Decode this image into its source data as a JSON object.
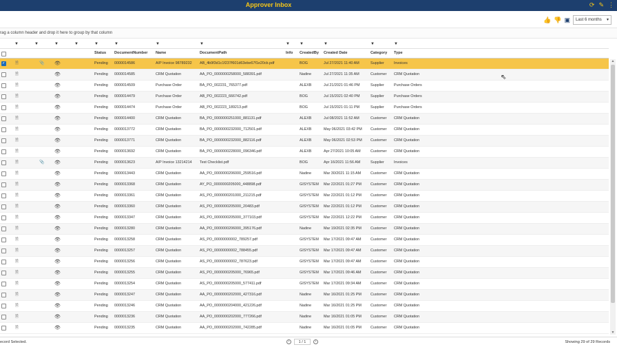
{
  "titlebar": {
    "title": "Approver Inbox",
    "icons": [
      "refresh-icon",
      "edit-icon",
      "more-icon"
    ]
  },
  "toolbar": {
    "icons": [
      "thumbs-up-icon",
      "thumbs-down-icon",
      "chat-icon"
    ],
    "period": "Last 6 months"
  },
  "groupbar": {
    "text": "rag a column header and drop it here to group by that column"
  },
  "columns": {
    "status": "Status",
    "number": "DocumentNumber",
    "name": "Name",
    "path": "DocumentPath",
    "info": "Info",
    "created_by": "CreatedBy",
    "created_date": "Created Date",
    "category": "Category",
    "type": "Type"
  },
  "rows": [
    {
      "status": "Pending",
      "number": "0000014586",
      "name": "A/P Invoice 98789232",
      "path": "AB_4b9f3d1c1f237f601d63ebe67f1e20cb.pdf",
      "by": "BOG",
      "date": "Jul 27/2021 11:40 AM",
      "cat": "Supplier",
      "type": "Invoices",
      "clip": true,
      "selected": true
    },
    {
      "status": "Pending",
      "number": "0000014585",
      "name": "CRM Quotation",
      "path": "AA_PO_0000000258000_588391.pdf",
      "by": "Nadine",
      "date": "Jul 27/2021 11:35 AM",
      "cat": "Customer",
      "type": "CRM Quotation"
    },
    {
      "status": "Pending",
      "number": "0000014509",
      "name": "Purchase Order",
      "path": "BA_PO_002231_765377.pdf",
      "by": "ALEXB",
      "date": "Jul 21/2021 01:46 PM",
      "cat": "Supplier",
      "type": "Purchase Orders"
    },
    {
      "status": "Pending",
      "number": "0000014479",
      "name": "Purchase Order",
      "path": "AB_PO_002223_666742.pdf",
      "by": "BOG",
      "date": "Jul 15/2021 02:40 PM",
      "cat": "Supplier",
      "type": "Purchase Orders"
    },
    {
      "status": "Pending",
      "number": "0000014474",
      "name": "Purchase Order",
      "path": "AB_PO_002223_189213.pdf",
      "by": "BOG",
      "date": "Jul 15/2021 01:11 PM",
      "cat": "Supplier",
      "type": "Purchase Orders"
    },
    {
      "status": "Pending",
      "number": "0000014400",
      "name": "CRM Quotation",
      "path": "BA_PO_0000000251000_881131.pdf",
      "by": "ALEXB",
      "date": "Jul 08/2021 11:52 AM",
      "cat": "Customer",
      "type": "CRM Quotation"
    },
    {
      "status": "Pending",
      "number": "0000013772",
      "name": "CRM Quotation",
      "path": "BA_PO_0000000232000_712501.pdf",
      "by": "ALEXB",
      "date": "May 06/2021 03:42 PM",
      "cat": "Customer",
      "type": "CRM Quotation"
    },
    {
      "status": "Pending",
      "number": "0000013771",
      "name": "CRM Quotation",
      "path": "BA_PO_0000000232000_882116.pdf",
      "by": "ALEXB",
      "date": "May 06/2021 02:53 PM",
      "cat": "Customer",
      "type": "CRM Quotation"
    },
    {
      "status": "Pending",
      "number": "0000013692",
      "name": "CRM Quotation",
      "path": "BA_PO_0000000228000_096346.pdf",
      "by": "ALEXB",
      "date": "Apr 27/2021 10:05 AM",
      "cat": "Customer",
      "type": "CRM Quotation"
    },
    {
      "status": "Pending",
      "number": "0000013623",
      "name": "A/P Invoice 13214214",
      "path": "Test Checklist.pdf",
      "by": "BOG",
      "date": "Apr 16/2021 11:56 AM",
      "cat": "Supplier",
      "type": "Invoices",
      "clip": true
    },
    {
      "status": "Pending",
      "number": "0000013443",
      "name": "CRM Quotation",
      "path": "AA_PO_0000000206000_259516.pdf",
      "by": "Nadine",
      "date": "Mar 30/2021 11:15 AM",
      "cat": "Customer",
      "type": "CRM Quotation"
    },
    {
      "status": "Pending",
      "number": "0000013368",
      "name": "CRM Quotation",
      "path": "AY_PO_0000000205000_448898.pdf",
      "by": "GISYSTEM",
      "date": "Mar 22/2021 01:27 PM",
      "cat": "Customer",
      "type": "CRM Quotation"
    },
    {
      "status": "Pending",
      "number": "0000013361",
      "name": "CRM Quotation",
      "path": "AS_PO_0000000201000_211215.pdf",
      "by": "GISYSTEM",
      "date": "Mar 22/2021 01:12 PM",
      "cat": "Customer",
      "type": "CRM Quotation"
    },
    {
      "status": "Pending",
      "number": "0000013360",
      "name": "CRM Quotation",
      "path": "AS_PO_0000000205000_20483.pdf",
      "by": "GISYSTEM",
      "date": "Mar 22/2021 01:12 PM",
      "cat": "Customer",
      "type": "CRM Quotation"
    },
    {
      "status": "Pending",
      "number": "0000013347",
      "name": "CRM Quotation",
      "path": "AS_PO_0000000205000_377103.pdf",
      "by": "GISYSTEM",
      "date": "Mar 22/2021 12:22 PM",
      "cat": "Customer",
      "type": "CRM Quotation"
    },
    {
      "status": "Pending",
      "number": "0000013280",
      "name": "CRM Quotation",
      "path": "AA_PO_0000000206000_395176.pdf",
      "by": "Nadine",
      "date": "Mar 19/2021 02:35 PM",
      "cat": "Customer",
      "type": "CRM Quotation"
    },
    {
      "status": "Pending",
      "number": "0000013258",
      "name": "CRM Quotation",
      "path": "AS_PO_00000000002_789257.pdf",
      "by": "GISYSTEM",
      "date": "Mar 17/2021 09:47 AM",
      "cat": "Customer",
      "type": "CRM Quotation"
    },
    {
      "status": "Pending",
      "number": "0000013257",
      "name": "CRM Quotation",
      "path": "AS_PO_00000000002_788455.pdf",
      "by": "GISYSTEM",
      "date": "Mar 17/2021 09:47 AM",
      "cat": "Customer",
      "type": "CRM Quotation"
    },
    {
      "status": "Pending",
      "number": "0000013256",
      "name": "CRM Quotation",
      "path": "AS_PO_00000000002_787623.pdf",
      "by": "GISYSTEM",
      "date": "Mar 17/2021 09:47 AM",
      "cat": "Customer",
      "type": "CRM Quotation"
    },
    {
      "status": "Pending",
      "number": "0000013255",
      "name": "CRM Quotation",
      "path": "AS_PO_0000000205000_76965.pdf",
      "by": "GISYSTEM",
      "date": "Mar 17/2021 09:46 AM",
      "cat": "Customer",
      "type": "CRM Quotation"
    },
    {
      "status": "Pending",
      "number": "0000013254",
      "name": "CRM Quotation",
      "path": "AS_PO_0000000205000_577411.pdf",
      "by": "GISYSTEM",
      "date": "Mar 17/2021 09:34 AM",
      "cat": "Customer",
      "type": "CRM Quotation"
    },
    {
      "status": "Pending",
      "number": "0000013247",
      "name": "CRM Quotation",
      "path": "AA_PO_0000000202000_427316.pdf",
      "by": "Nadine",
      "date": "Mar 16/2021 01:25 PM",
      "cat": "Customer",
      "type": "CRM Quotation"
    },
    {
      "status": "Pending",
      "number": "0000013246",
      "name": "CRM Quotation",
      "path": "AA_PO_0000000204000_421226.pdf",
      "by": "Nadine",
      "date": "Mar 16/2021 01:25 PM",
      "cat": "Customer",
      "type": "CRM Quotation"
    },
    {
      "status": "Pending",
      "number": "0000013236",
      "name": "CRM Quotation",
      "path": "AA_PO_0000000202000_777266.pdf",
      "by": "Nadine",
      "date": "Mar 16/2021 01:05 PM",
      "cat": "Customer",
      "type": "CRM Quotation"
    },
    {
      "status": "Pending",
      "number": "0000013235",
      "name": "CRM Quotation",
      "path": "AA_PO_0000000202000_742285.pdf",
      "by": "Nadine",
      "date": "Mar 16/2021 01:05 PM",
      "cat": "Customer",
      "type": "CRM Quotation"
    }
  ],
  "footer": {
    "left": "ecord Selected.",
    "page": "1 / 1",
    "right": "Showing 29 of 29 Records"
  }
}
